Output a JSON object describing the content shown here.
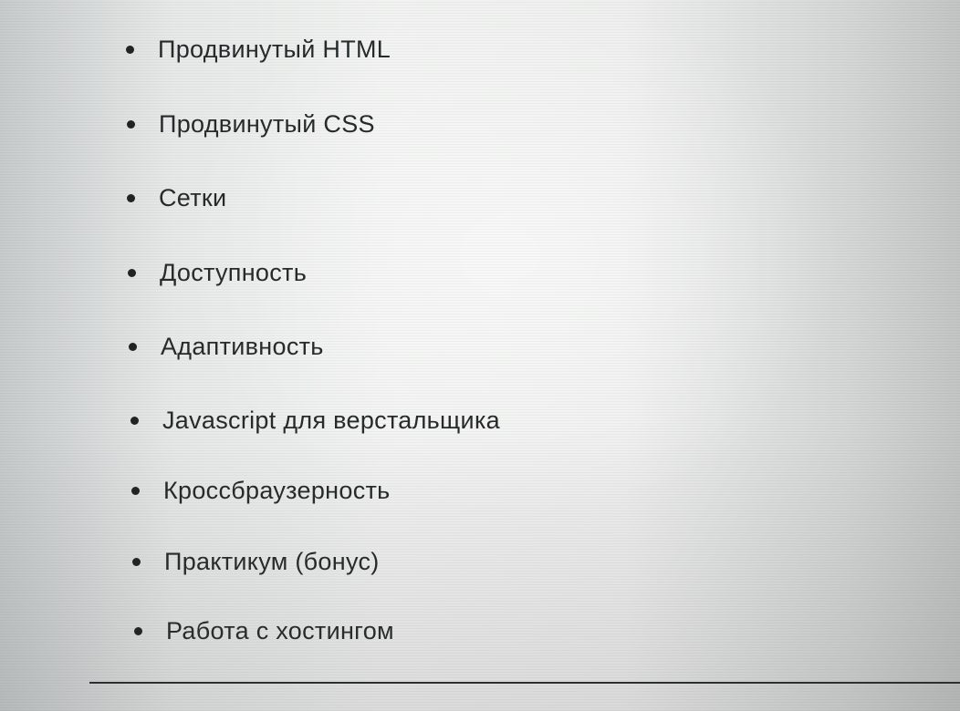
{
  "course_topics": [
    "Продвинутый HTML",
    "Продвинутый CSS",
    "Сетки",
    "Доступность",
    "Адаптивность",
    "Javascript для верстальщика",
    "Кроссбраузерность",
    "Практикум (бонус)",
    "Работа с хостингом"
  ],
  "colors": {
    "text": "#262a2a",
    "bullet": "#1f2322",
    "divider": "#2a2d2d"
  }
}
